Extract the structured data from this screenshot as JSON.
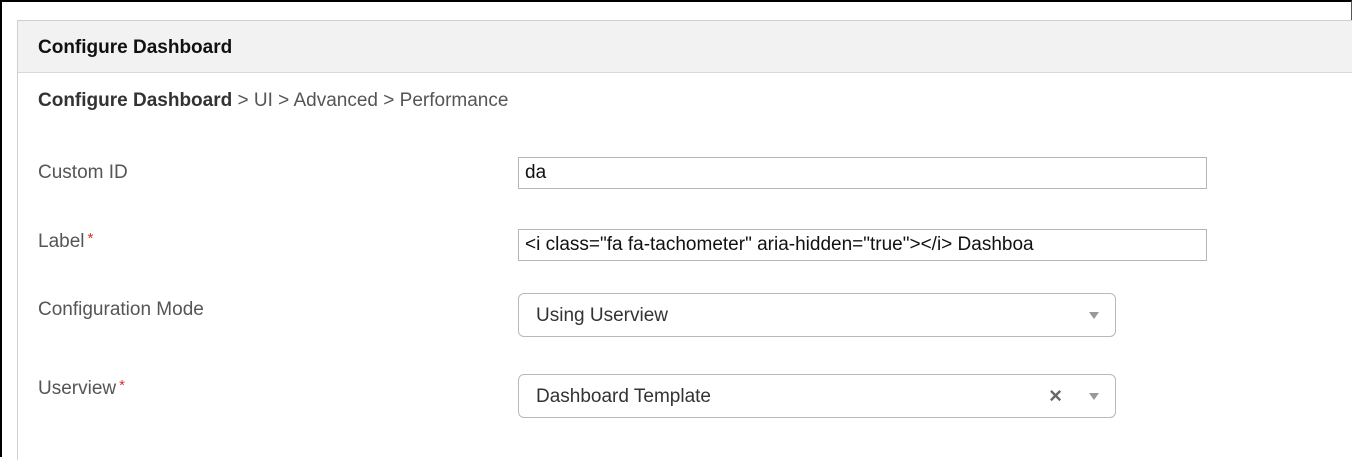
{
  "panel": {
    "title": "Configure Dashboard"
  },
  "breadcrumb": {
    "root": "Configure Dashboard",
    "path": " > UI > Advanced > Performance"
  },
  "form": {
    "custom_id": {
      "label": "Custom ID",
      "value": "da"
    },
    "label_field": {
      "label": "Label",
      "required_mark": "*",
      "value": "<i class=\"fa fa-tachometer\" aria-hidden=\"true\"></i> Dashboa"
    },
    "configuration_mode": {
      "label": "Configuration Mode",
      "selected": "Using Userview"
    },
    "userview": {
      "label": "Userview",
      "required_mark": "*",
      "selected": "Dashboard Template",
      "clear_glyph": "×"
    }
  },
  "icons": {
    "dropdown": "chevron-down-icon",
    "clear": "close-icon"
  }
}
